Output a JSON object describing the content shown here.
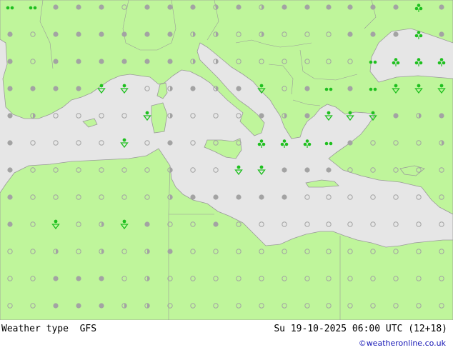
{
  "map": {
    "colors": {
      "sea": "#e6e6e6",
      "land": "#bff59b",
      "border": "#9a9a9a",
      "symbol_gray": "#a3a3a3",
      "symbol_green": "#1fc01f"
    },
    "symbols": [
      [
        14,
        10,
        "drizzle"
      ],
      [
        46,
        10,
        "drizzle"
      ],
      [
        78,
        10,
        "dot"
      ],
      [
        110,
        10,
        "dot"
      ],
      [
        142,
        10,
        "dot"
      ],
      [
        174,
        10,
        "circle"
      ],
      [
        206,
        10,
        "dot"
      ],
      [
        238,
        10,
        "dot"
      ],
      [
        270,
        10,
        "dot"
      ],
      [
        302,
        10,
        "half"
      ],
      [
        334,
        10,
        "dot"
      ],
      [
        366,
        10,
        "half"
      ],
      [
        398,
        10,
        "dot"
      ],
      [
        430,
        10,
        "dot"
      ],
      [
        460,
        10,
        "dot"
      ],
      [
        490,
        10,
        "dot"
      ],
      [
        522,
        10,
        "dot"
      ],
      [
        554,
        10,
        "dot"
      ],
      [
        586,
        10,
        "rain-trefoil"
      ],
      [
        618,
        10,
        "dot"
      ],
      [
        14,
        48,
        "dot"
      ],
      [
        46,
        48,
        "circle"
      ],
      [
        78,
        48,
        "dot"
      ],
      [
        110,
        48,
        "dot"
      ],
      [
        142,
        48,
        "dot"
      ],
      [
        174,
        48,
        "dot"
      ],
      [
        206,
        48,
        "dot"
      ],
      [
        238,
        48,
        "dot"
      ],
      [
        270,
        48,
        "half"
      ],
      [
        302,
        48,
        "half"
      ],
      [
        334,
        48,
        "circle"
      ],
      [
        366,
        48,
        "half"
      ],
      [
        398,
        48,
        "circle"
      ],
      [
        430,
        48,
        "circle"
      ],
      [
        460,
        48,
        "circle"
      ],
      [
        490,
        48,
        "dot"
      ],
      [
        522,
        48,
        "dot"
      ],
      [
        554,
        48,
        "dot"
      ],
      [
        586,
        48,
        "rain-trefoil"
      ],
      [
        618,
        48,
        "dot"
      ],
      [
        14,
        86,
        "dot"
      ],
      [
        46,
        86,
        "circle"
      ],
      [
        78,
        86,
        "dot"
      ],
      [
        110,
        86,
        "dot"
      ],
      [
        142,
        86,
        "dot"
      ],
      [
        174,
        86,
        "dot"
      ],
      [
        206,
        86,
        "dot"
      ],
      [
        238,
        86,
        "dot"
      ],
      [
        270,
        86,
        "half"
      ],
      [
        302,
        86,
        "half"
      ],
      [
        334,
        86,
        "circle"
      ],
      [
        366,
        86,
        "circle"
      ],
      [
        398,
        86,
        "circle"
      ],
      [
        430,
        86,
        "circle"
      ],
      [
        460,
        86,
        "circle"
      ],
      [
        490,
        86,
        "circle"
      ],
      [
        522,
        86,
        "drizzle"
      ],
      [
        554,
        86,
        "rain-trefoil"
      ],
      [
        586,
        86,
        "rain-trefoil"
      ],
      [
        618,
        86,
        "rain-trefoil"
      ],
      [
        14,
        124,
        "dot"
      ],
      [
        46,
        124,
        "dot"
      ],
      [
        78,
        124,
        "dot"
      ],
      [
        110,
        124,
        "dot"
      ],
      [
        142,
        124,
        "shower"
      ],
      [
        174,
        124,
        "shower"
      ],
      [
        206,
        124,
        "circle"
      ],
      [
        238,
        124,
        "half"
      ],
      [
        270,
        124,
        "dot"
      ],
      [
        302,
        124,
        "half"
      ],
      [
        334,
        124,
        "dot"
      ],
      [
        366,
        124,
        "shower"
      ],
      [
        398,
        124,
        "circle"
      ],
      [
        430,
        124,
        "dot"
      ],
      [
        460,
        124,
        "drizzle"
      ],
      [
        490,
        124,
        "dot"
      ],
      [
        522,
        124,
        "drizzle"
      ],
      [
        554,
        124,
        "shower"
      ],
      [
        586,
        124,
        "shower"
      ],
      [
        618,
        124,
        "shower"
      ],
      [
        14,
        162,
        "dot"
      ],
      [
        46,
        162,
        "half"
      ],
      [
        78,
        162,
        "circle"
      ],
      [
        110,
        162,
        "circle"
      ],
      [
        142,
        162,
        "circle"
      ],
      [
        174,
        162,
        "circle"
      ],
      [
        206,
        162,
        "shower"
      ],
      [
        238,
        162,
        "half"
      ],
      [
        270,
        162,
        "circle"
      ],
      [
        302,
        162,
        "circle"
      ],
      [
        334,
        162,
        "circle"
      ],
      [
        366,
        162,
        "dot"
      ],
      [
        398,
        162,
        "half"
      ],
      [
        430,
        162,
        "dot"
      ],
      [
        460,
        162,
        "shower"
      ],
      [
        490,
        162,
        "shower"
      ],
      [
        522,
        162,
        "shower"
      ],
      [
        554,
        162,
        "dot"
      ],
      [
        586,
        162,
        "half"
      ],
      [
        618,
        162,
        "dot"
      ],
      [
        14,
        200,
        "dot"
      ],
      [
        46,
        200,
        "circle"
      ],
      [
        78,
        200,
        "circle"
      ],
      [
        110,
        200,
        "circle"
      ],
      [
        142,
        200,
        "circle"
      ],
      [
        174,
        200,
        "shower"
      ],
      [
        206,
        200,
        "circle"
      ],
      [
        238,
        200,
        "dot"
      ],
      [
        270,
        200,
        "circle"
      ],
      [
        302,
        200,
        "circle"
      ],
      [
        334,
        200,
        "circle"
      ],
      [
        366,
        200,
        "rain-trefoil"
      ],
      [
        398,
        200,
        "rain-trefoil"
      ],
      [
        430,
        200,
        "rain-trefoil"
      ],
      [
        460,
        200,
        "drizzle"
      ],
      [
        490,
        200,
        "dot"
      ],
      [
        522,
        200,
        "circle"
      ],
      [
        554,
        200,
        "circle"
      ],
      [
        586,
        200,
        "circle"
      ],
      [
        618,
        200,
        "half"
      ],
      [
        14,
        238,
        "dot"
      ],
      [
        46,
        238,
        "circle"
      ],
      [
        78,
        238,
        "circle"
      ],
      [
        110,
        238,
        "circle"
      ],
      [
        142,
        238,
        "circle"
      ],
      [
        174,
        238,
        "circle"
      ],
      [
        206,
        238,
        "circle"
      ],
      [
        238,
        238,
        "half"
      ],
      [
        270,
        238,
        "circle"
      ],
      [
        302,
        238,
        "circle"
      ],
      [
        334,
        238,
        "shower"
      ],
      [
        366,
        238,
        "shower"
      ],
      [
        398,
        238,
        "dot"
      ],
      [
        430,
        238,
        "dot"
      ],
      [
        460,
        238,
        "dot"
      ],
      [
        490,
        238,
        "circle"
      ],
      [
        522,
        238,
        "circle"
      ],
      [
        554,
        238,
        "circle"
      ],
      [
        586,
        238,
        "circle"
      ],
      [
        618,
        238,
        "circle"
      ],
      [
        14,
        276,
        "dot"
      ],
      [
        46,
        276,
        "circle"
      ],
      [
        78,
        276,
        "circle"
      ],
      [
        110,
        276,
        "circle"
      ],
      [
        142,
        276,
        "circle"
      ],
      [
        174,
        276,
        "circle"
      ],
      [
        206,
        276,
        "circle"
      ],
      [
        238,
        276,
        "half"
      ],
      [
        270,
        276,
        "dot"
      ],
      [
        302,
        276,
        "dot"
      ],
      [
        334,
        276,
        "dot"
      ],
      [
        366,
        276,
        "dot"
      ],
      [
        398,
        276,
        "dot"
      ],
      [
        430,
        276,
        "circle"
      ],
      [
        460,
        276,
        "circle"
      ],
      [
        490,
        276,
        "circle"
      ],
      [
        522,
        276,
        "circle"
      ],
      [
        554,
        276,
        "circle"
      ],
      [
        586,
        276,
        "circle"
      ],
      [
        618,
        276,
        "circle"
      ],
      [
        14,
        314,
        "dot"
      ],
      [
        46,
        314,
        "circle"
      ],
      [
        78,
        314,
        "shower"
      ],
      [
        110,
        314,
        "circle"
      ],
      [
        142,
        314,
        "half"
      ],
      [
        174,
        314,
        "shower"
      ],
      [
        206,
        314,
        "dot"
      ],
      [
        238,
        314,
        "circle"
      ],
      [
        270,
        314,
        "circle"
      ],
      [
        302,
        314,
        "dot"
      ],
      [
        334,
        314,
        "circle"
      ],
      [
        366,
        314,
        "circle"
      ],
      [
        398,
        314,
        "circle"
      ],
      [
        430,
        314,
        "circle"
      ],
      [
        460,
        314,
        "circle"
      ],
      [
        490,
        314,
        "circle"
      ],
      [
        522,
        314,
        "circle"
      ],
      [
        554,
        314,
        "circle"
      ],
      [
        586,
        314,
        "circle"
      ],
      [
        618,
        314,
        "circle"
      ],
      [
        14,
        352,
        "circle"
      ],
      [
        46,
        352,
        "circle"
      ],
      [
        78,
        352,
        "half"
      ],
      [
        110,
        352,
        "circle"
      ],
      [
        142,
        352,
        "half"
      ],
      [
        174,
        352,
        "circle"
      ],
      [
        206,
        352,
        "half"
      ],
      [
        238,
        352,
        "dot"
      ],
      [
        270,
        352,
        "circle"
      ],
      [
        302,
        352,
        "circle"
      ],
      [
        334,
        352,
        "circle"
      ],
      [
        366,
        352,
        "circle"
      ],
      [
        398,
        352,
        "circle"
      ],
      [
        430,
        352,
        "circle"
      ],
      [
        460,
        352,
        "circle"
      ],
      [
        490,
        352,
        "circle"
      ],
      [
        522,
        352,
        "circle"
      ],
      [
        554,
        352,
        "circle"
      ],
      [
        586,
        352,
        "circle"
      ],
      [
        618,
        352,
        "circle"
      ],
      [
        14,
        390,
        "circle"
      ],
      [
        46,
        390,
        "circle"
      ],
      [
        78,
        390,
        "dot"
      ],
      [
        110,
        390,
        "dot"
      ],
      [
        142,
        390,
        "dot"
      ],
      [
        174,
        390,
        "circle"
      ],
      [
        206,
        390,
        "half"
      ],
      [
        238,
        390,
        "circle"
      ],
      [
        270,
        390,
        "circle"
      ],
      [
        302,
        390,
        "circle"
      ],
      [
        334,
        390,
        "circle"
      ],
      [
        366,
        390,
        "circle"
      ],
      [
        398,
        390,
        "circle"
      ],
      [
        430,
        390,
        "circle"
      ],
      [
        460,
        390,
        "circle"
      ],
      [
        490,
        390,
        "circle"
      ],
      [
        522,
        390,
        "circle"
      ],
      [
        554,
        390,
        "circle"
      ],
      [
        586,
        390,
        "circle"
      ],
      [
        618,
        390,
        "circle"
      ],
      [
        14,
        428,
        "circle"
      ],
      [
        46,
        428,
        "circle"
      ],
      [
        78,
        428,
        "dot"
      ],
      [
        110,
        428,
        "dot"
      ],
      [
        142,
        428,
        "dot"
      ],
      [
        174,
        428,
        "half"
      ],
      [
        206,
        428,
        "half"
      ],
      [
        238,
        428,
        "circle"
      ],
      [
        270,
        428,
        "circle"
      ],
      [
        302,
        428,
        "circle"
      ],
      [
        334,
        428,
        "circle"
      ],
      [
        366,
        428,
        "circle"
      ],
      [
        398,
        428,
        "circle"
      ],
      [
        430,
        428,
        "circle"
      ],
      [
        460,
        428,
        "circle"
      ],
      [
        490,
        428,
        "circle"
      ],
      [
        522,
        428,
        "circle"
      ],
      [
        554,
        428,
        "circle"
      ],
      [
        586,
        428,
        "circle"
      ],
      [
        618,
        428,
        "circle"
      ]
    ]
  },
  "footer": {
    "title": "Weather type  GFS",
    "datetime": "Su 19-10-2025 06:00 UTC (12+18)",
    "credit": "©weatheronline.co.uk"
  }
}
